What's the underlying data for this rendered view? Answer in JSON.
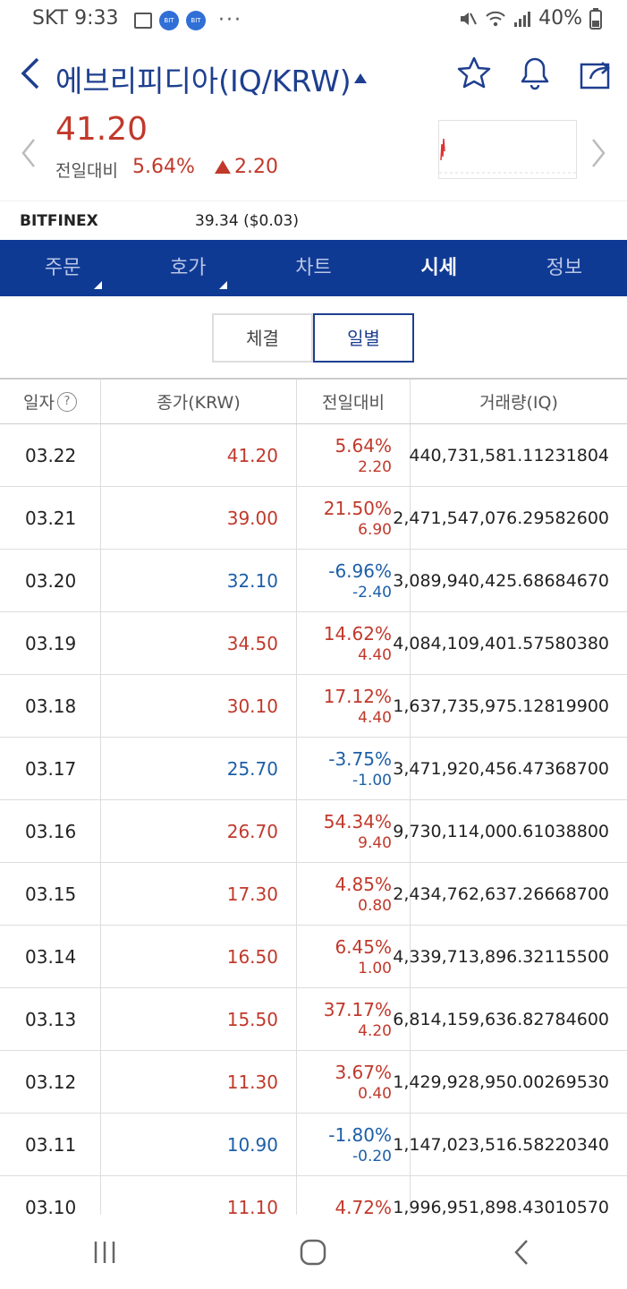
{
  "status": {
    "carrier_time": "SKT 9:33",
    "app_badge": "BIT",
    "more": "···",
    "battery": "40%"
  },
  "header": {
    "title": "에브리피디아(IQ/KRW)"
  },
  "price": {
    "current": "41.20",
    "prev_label": "전일대비",
    "pct": "5.64%",
    "change": "2.20"
  },
  "exchange": {
    "name": "BITFINEX",
    "value": "39.34 ($0.03)"
  },
  "nav": {
    "tabs": [
      {
        "label": "주문"
      },
      {
        "label": "호가"
      },
      {
        "label": "차트"
      },
      {
        "label": "시세"
      },
      {
        "label": "정보"
      }
    ]
  },
  "segment": {
    "trade": "체결",
    "daily": "일별"
  },
  "table": {
    "headers": {
      "date": "일자",
      "help": "?",
      "close": "종가(KRW)",
      "change": "전일대비",
      "volume": "거래량(IQ)"
    },
    "rows": [
      {
        "date": "03.22",
        "close": "41.20",
        "pct": "5.64%",
        "chg": "2.20",
        "vol": "440,731,581.11231804",
        "dir": "up"
      },
      {
        "date": "03.21",
        "close": "39.00",
        "pct": "21.50%",
        "chg": "6.90",
        "vol": "2,471,547,076.29582600",
        "dir": "up"
      },
      {
        "date": "03.20",
        "close": "32.10",
        "pct": "-6.96%",
        "chg": "-2.40",
        "vol": "3,089,940,425.68684670",
        "dir": "down"
      },
      {
        "date": "03.19",
        "close": "34.50",
        "pct": "14.62%",
        "chg": "4.40",
        "vol": "4,084,109,401.57580380",
        "dir": "up"
      },
      {
        "date": "03.18",
        "close": "30.10",
        "pct": "17.12%",
        "chg": "4.40",
        "vol": "1,637,735,975.12819900",
        "dir": "up"
      },
      {
        "date": "03.17",
        "close": "25.70",
        "pct": "-3.75%",
        "chg": "-1.00",
        "vol": "3,471,920,456.47368700",
        "dir": "down"
      },
      {
        "date": "03.16",
        "close": "26.70",
        "pct": "54.34%",
        "chg": "9.40",
        "vol": "9,730,114,000.61038800",
        "dir": "up"
      },
      {
        "date": "03.15",
        "close": "17.30",
        "pct": "4.85%",
        "chg": "0.80",
        "vol": "2,434,762,637.26668700",
        "dir": "up"
      },
      {
        "date": "03.14",
        "close": "16.50",
        "pct": "6.45%",
        "chg": "1.00",
        "vol": "4,339,713,896.32115500",
        "dir": "up"
      },
      {
        "date": "03.13",
        "close": "15.50",
        "pct": "37.17%",
        "chg": "4.20",
        "vol": "6,814,159,636.82784600",
        "dir": "up"
      },
      {
        "date": "03.12",
        "close": "11.30",
        "pct": "3.67%",
        "chg": "0.40",
        "vol": "1,429,928,950.00269530",
        "dir": "up"
      },
      {
        "date": "03.11",
        "close": "10.90",
        "pct": "-1.80%",
        "chg": "-0.20",
        "vol": "1,147,023,516.58220340",
        "dir": "down"
      },
      {
        "date": "03.10",
        "close": "11.10",
        "pct": "4.72%",
        "chg": "",
        "vol": "1,996,951,898.43010570",
        "dir": "up"
      }
    ]
  },
  "colors": {
    "up": "#c0392b",
    "down": "#1d5fa8",
    "nav_bg": "#0f3a94",
    "accent": "#1e3f8f"
  },
  "icons": {
    "back": "chevron-left-icon",
    "favorite": "star-icon",
    "alert": "bell-icon",
    "share": "share-icon",
    "prev_coin": "chevron-left-icon",
    "next_coin": "chevron-right-icon",
    "recent_apps": "recent-apps-icon",
    "home": "home-icon",
    "system_back": "back-icon"
  }
}
